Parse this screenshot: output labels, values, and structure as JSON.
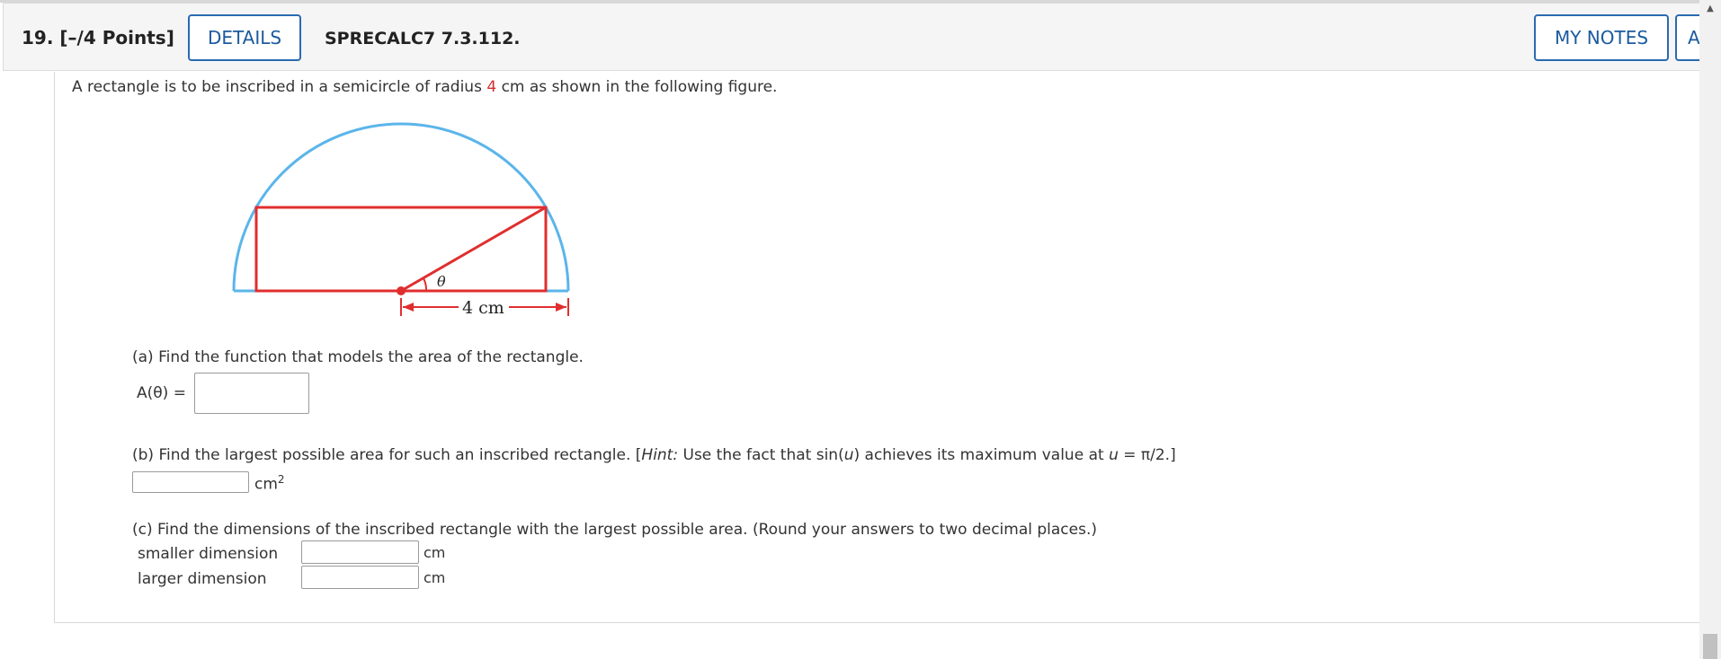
{
  "header": {
    "question_number": "19.",
    "points": "[–/4 Points]",
    "details_label": "DETAILS",
    "question_id": "SPRECALC7 7.3.112.",
    "my_notes_label": "MY NOTES",
    "ask_label": "A"
  },
  "problem": {
    "intro_before": "A rectangle is to be inscribed in a semicircle of radius ",
    "radius_value": "4",
    "intro_after": " cm as shown in the following figure."
  },
  "figure": {
    "theta_label": "θ",
    "radius_label": "4 cm",
    "semicircle_color": "#5bb5ea",
    "rectangle_color": "#e02e2e"
  },
  "part_a": {
    "prompt": "(a) Find the function that models the area of the rectangle.",
    "label": "A(θ) =",
    "value": ""
  },
  "part_b": {
    "prompt_start": "(b) Find the largest possible area for such an inscribed rectangle. [",
    "hint_word": "Hint:",
    "prompt_mid": " Use the fact that  sin(",
    "var_u": "u",
    "prompt_mid2": ")  achieves its maximum value at  ",
    "var_u2": "u",
    "prompt_end": " = π/2.]",
    "unit": "cm",
    "unit_exp": "2",
    "value": ""
  },
  "part_c": {
    "prompt": "(c) Find the dimensions of the inscribed rectangle with the largest possible area. (Round your answers to two decimal places.)",
    "smaller_label": "smaller dimension",
    "larger_label": "larger dimension",
    "unit": "cm",
    "smaller_value": "",
    "larger_value": ""
  },
  "scrollbar": {
    "up_arrow": "▲"
  }
}
